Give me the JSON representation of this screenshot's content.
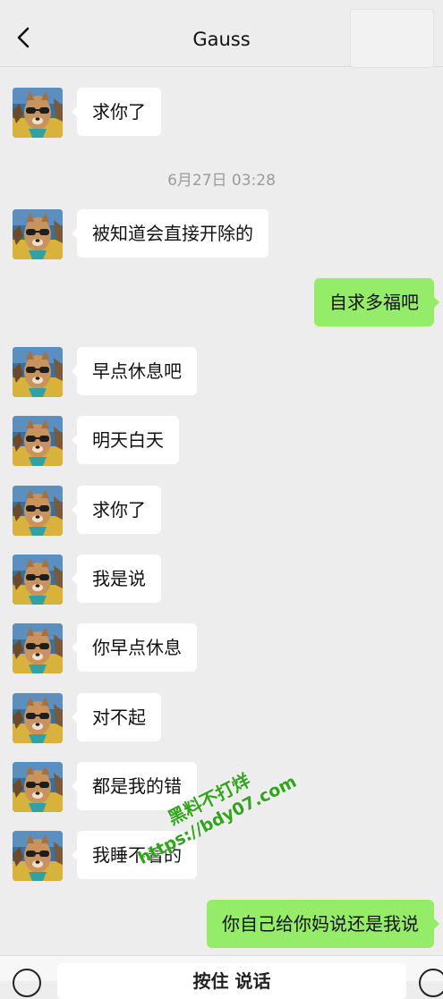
{
  "header": {
    "title": "Gauss",
    "back_icon": "chevron-left-icon"
  },
  "timestamp": "6月27日 03:28",
  "messages": [
    {
      "side": "in",
      "text": "求你了"
    },
    {
      "side": "in",
      "text": "被知道会直接开除的"
    },
    {
      "side": "out",
      "text": "自求多福吧"
    },
    {
      "side": "in",
      "text": "早点休息吧"
    },
    {
      "side": "in",
      "text": "明天白天"
    },
    {
      "side": "in",
      "text": "求你了"
    },
    {
      "side": "in",
      "text": "我是说"
    },
    {
      "side": "in",
      "text": "你早点休息"
    },
    {
      "side": "in",
      "text": "对不起"
    },
    {
      "side": "in",
      "text": "都是我的错"
    },
    {
      "side": "in",
      "text": "我睡不着的"
    },
    {
      "side": "out",
      "text": "你自己给你妈说还是我说"
    }
  ],
  "watermark": {
    "line1": "黑料不打烊",
    "line2": "https://bdy07.com"
  },
  "input_bar": {
    "talk_label": "按住 说话",
    "voice_icon": "voice-icon",
    "emoji_icon": "emoji-icon"
  },
  "colors": {
    "background": "#ededed",
    "incoming_bubble": "#ffffff",
    "outgoing_bubble": "#95ec69",
    "timestamp": "#9b9b9b"
  }
}
